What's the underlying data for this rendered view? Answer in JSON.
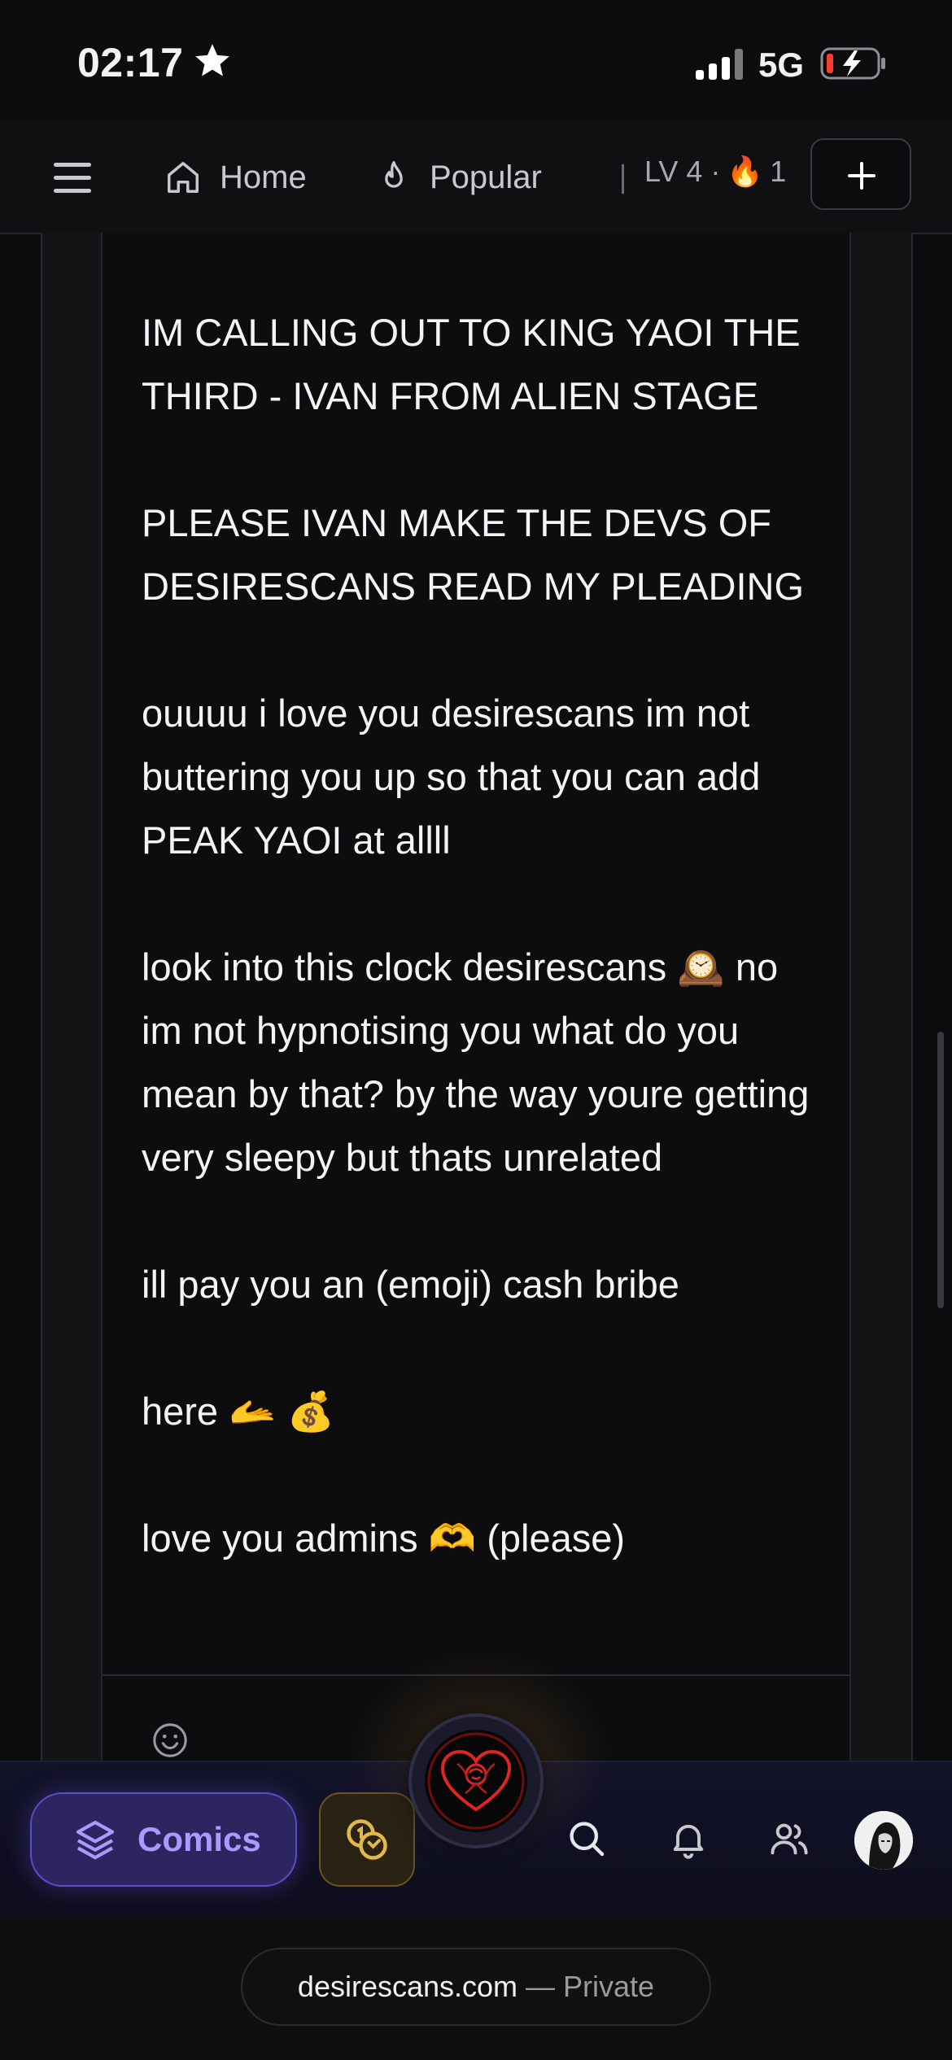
{
  "status_bar": {
    "time": "02:17",
    "network": "5G"
  },
  "top_nav": {
    "home_label": "Home",
    "popular_label": "Popular",
    "level_text": "LV 4 ·",
    "streak_count": "1"
  },
  "post": {
    "paragraphs": [
      "IM CALLING OUT TO KING YAOI THE THIRD - IVAN FROM ALIEN STAGE",
      "PLEASE IVAN MAKE THE DEVS OF DESIRESCANS READ MY PLEADING",
      "ouuuu i love you desirescans im not buttering you up so that you can add PEAK YAOI at allll",
      "look into this clock desirescans 🕰️ no im not hypnotising you what do you mean by that? by the way youre getting very sleepy but thats unrelated",
      "ill pay you an (emoji) cash bribe",
      "here 🫴 💰",
      "love you admins 🫶 (please)"
    ]
  },
  "bottom_nav": {
    "comics_label": "Comics"
  },
  "browser": {
    "domain": "desirescans.com",
    "separator": "—",
    "mode": "Private"
  },
  "colors": {
    "accent": "#a99aff",
    "coins": "#e0b94a",
    "logo": "#e02424"
  }
}
